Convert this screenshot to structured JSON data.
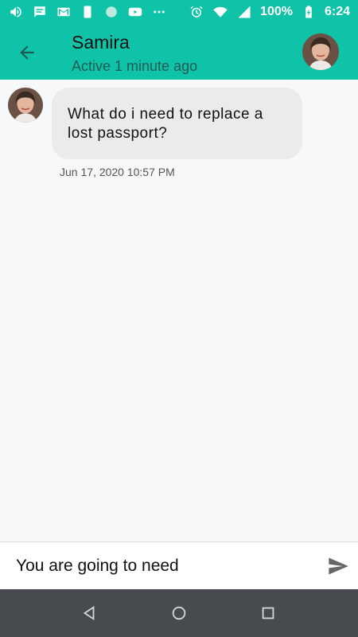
{
  "status_bar": {
    "battery_percent": "100%",
    "time": "6:24",
    "left_icons": [
      "volume-icon",
      "message-icon",
      "gmail-icon",
      "phone-icon",
      "circle-app-icon",
      "youtube-icon",
      "more-dots-icon"
    ],
    "right_icons": [
      "alarm-icon",
      "wifi-icon",
      "signal-icon",
      "battery-charging-icon"
    ],
    "background_color": "#0fc3a8"
  },
  "header": {
    "back_icon": "arrow-back-icon",
    "contact_name": "Samira",
    "contact_status": "Active 1 minute ago",
    "avatar_icon": "contact-avatar"
  },
  "messages": [
    {
      "sender": "Samira",
      "text": "What do i need to replace a lost passport?",
      "timestamp": "Jun 17, 2020 10:57 PM"
    }
  ],
  "composer": {
    "value": "You are going to need",
    "send_icon": "send-icon"
  },
  "nav_bar": {
    "buttons": [
      "back-triangle-icon",
      "home-circle-icon",
      "recents-square-icon"
    ]
  }
}
